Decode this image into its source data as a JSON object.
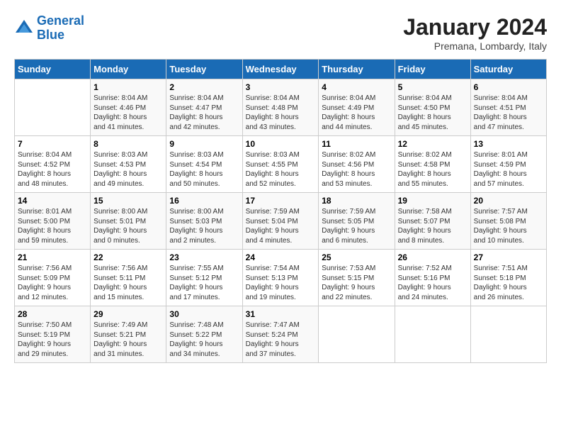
{
  "logo": {
    "line1": "General",
    "line2": "Blue"
  },
  "title": "January 2024",
  "subtitle": "Premana, Lombardy, Italy",
  "days_of_week": [
    "Sunday",
    "Monday",
    "Tuesday",
    "Wednesday",
    "Thursday",
    "Friday",
    "Saturday"
  ],
  "weeks": [
    [
      {
        "num": "",
        "detail": ""
      },
      {
        "num": "1",
        "detail": "Sunrise: 8:04 AM\nSunset: 4:46 PM\nDaylight: 8 hours\nand 41 minutes."
      },
      {
        "num": "2",
        "detail": "Sunrise: 8:04 AM\nSunset: 4:47 PM\nDaylight: 8 hours\nand 42 minutes."
      },
      {
        "num": "3",
        "detail": "Sunrise: 8:04 AM\nSunset: 4:48 PM\nDaylight: 8 hours\nand 43 minutes."
      },
      {
        "num": "4",
        "detail": "Sunrise: 8:04 AM\nSunset: 4:49 PM\nDaylight: 8 hours\nand 44 minutes."
      },
      {
        "num": "5",
        "detail": "Sunrise: 8:04 AM\nSunset: 4:50 PM\nDaylight: 8 hours\nand 45 minutes."
      },
      {
        "num": "6",
        "detail": "Sunrise: 8:04 AM\nSunset: 4:51 PM\nDaylight: 8 hours\nand 47 minutes."
      }
    ],
    [
      {
        "num": "7",
        "detail": "Sunrise: 8:04 AM\nSunset: 4:52 PM\nDaylight: 8 hours\nand 48 minutes."
      },
      {
        "num": "8",
        "detail": "Sunrise: 8:03 AM\nSunset: 4:53 PM\nDaylight: 8 hours\nand 49 minutes."
      },
      {
        "num": "9",
        "detail": "Sunrise: 8:03 AM\nSunset: 4:54 PM\nDaylight: 8 hours\nand 50 minutes."
      },
      {
        "num": "10",
        "detail": "Sunrise: 8:03 AM\nSunset: 4:55 PM\nDaylight: 8 hours\nand 52 minutes."
      },
      {
        "num": "11",
        "detail": "Sunrise: 8:02 AM\nSunset: 4:56 PM\nDaylight: 8 hours\nand 53 minutes."
      },
      {
        "num": "12",
        "detail": "Sunrise: 8:02 AM\nSunset: 4:58 PM\nDaylight: 8 hours\nand 55 minutes."
      },
      {
        "num": "13",
        "detail": "Sunrise: 8:01 AM\nSunset: 4:59 PM\nDaylight: 8 hours\nand 57 minutes."
      }
    ],
    [
      {
        "num": "14",
        "detail": "Sunrise: 8:01 AM\nSunset: 5:00 PM\nDaylight: 8 hours\nand 59 minutes."
      },
      {
        "num": "15",
        "detail": "Sunrise: 8:00 AM\nSunset: 5:01 PM\nDaylight: 9 hours\nand 0 minutes."
      },
      {
        "num": "16",
        "detail": "Sunrise: 8:00 AM\nSunset: 5:03 PM\nDaylight: 9 hours\nand 2 minutes."
      },
      {
        "num": "17",
        "detail": "Sunrise: 7:59 AM\nSunset: 5:04 PM\nDaylight: 9 hours\nand 4 minutes."
      },
      {
        "num": "18",
        "detail": "Sunrise: 7:59 AM\nSunset: 5:05 PM\nDaylight: 9 hours\nand 6 minutes."
      },
      {
        "num": "19",
        "detail": "Sunrise: 7:58 AM\nSunset: 5:07 PM\nDaylight: 9 hours\nand 8 minutes."
      },
      {
        "num": "20",
        "detail": "Sunrise: 7:57 AM\nSunset: 5:08 PM\nDaylight: 9 hours\nand 10 minutes."
      }
    ],
    [
      {
        "num": "21",
        "detail": "Sunrise: 7:56 AM\nSunset: 5:09 PM\nDaylight: 9 hours\nand 12 minutes."
      },
      {
        "num": "22",
        "detail": "Sunrise: 7:56 AM\nSunset: 5:11 PM\nDaylight: 9 hours\nand 15 minutes."
      },
      {
        "num": "23",
        "detail": "Sunrise: 7:55 AM\nSunset: 5:12 PM\nDaylight: 9 hours\nand 17 minutes."
      },
      {
        "num": "24",
        "detail": "Sunrise: 7:54 AM\nSunset: 5:13 PM\nDaylight: 9 hours\nand 19 minutes."
      },
      {
        "num": "25",
        "detail": "Sunrise: 7:53 AM\nSunset: 5:15 PM\nDaylight: 9 hours\nand 22 minutes."
      },
      {
        "num": "26",
        "detail": "Sunrise: 7:52 AM\nSunset: 5:16 PM\nDaylight: 9 hours\nand 24 minutes."
      },
      {
        "num": "27",
        "detail": "Sunrise: 7:51 AM\nSunset: 5:18 PM\nDaylight: 9 hours\nand 26 minutes."
      }
    ],
    [
      {
        "num": "28",
        "detail": "Sunrise: 7:50 AM\nSunset: 5:19 PM\nDaylight: 9 hours\nand 29 minutes."
      },
      {
        "num": "29",
        "detail": "Sunrise: 7:49 AM\nSunset: 5:21 PM\nDaylight: 9 hours\nand 31 minutes."
      },
      {
        "num": "30",
        "detail": "Sunrise: 7:48 AM\nSunset: 5:22 PM\nDaylight: 9 hours\nand 34 minutes."
      },
      {
        "num": "31",
        "detail": "Sunrise: 7:47 AM\nSunset: 5:24 PM\nDaylight: 9 hours\nand 37 minutes."
      },
      {
        "num": "",
        "detail": ""
      },
      {
        "num": "",
        "detail": ""
      },
      {
        "num": "",
        "detail": ""
      }
    ]
  ]
}
